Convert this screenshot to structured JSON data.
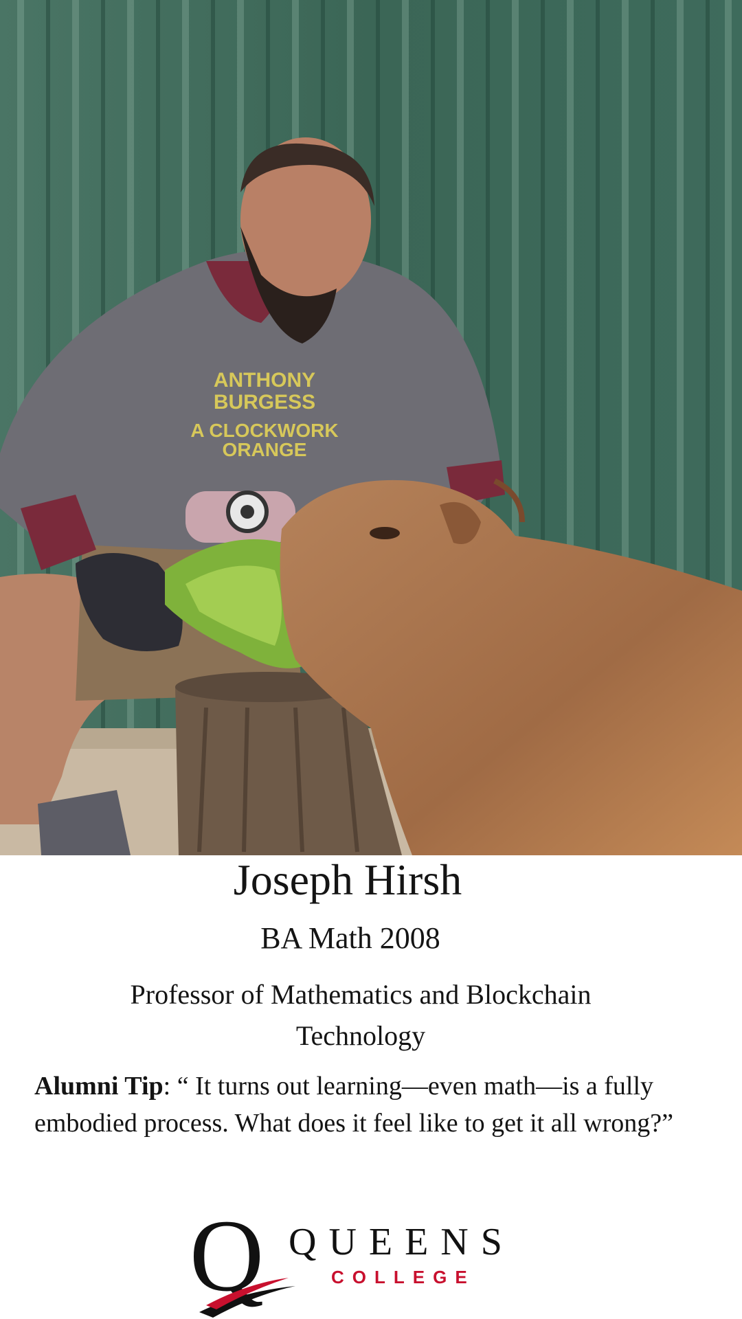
{
  "profile": {
    "name": "Joseph Hirsh",
    "degree": "BA Math 2008",
    "title": "Professor of Mathematics and Blockchain Technology"
  },
  "tip": {
    "label": "Alumni Tip",
    "separator": ": ",
    "quote": "“ It turns out learning—even math—is a fully embodied process. What does it feel like to get it all wrong?”"
  },
  "photo": {
    "shirt_text_line1": "ANTHONY",
    "shirt_text_line2": "BURGESS",
    "shirt_text_line3": "A CLOCKWORK",
    "shirt_text_line4": "ORANGE"
  },
  "logo": {
    "letter": "Q",
    "word_top": "QUEENS",
    "word_bottom": "COLLEGE",
    "accent_color": "#c8102e"
  },
  "colors": {
    "wall": "#3f6a5a",
    "text": "#141414"
  }
}
